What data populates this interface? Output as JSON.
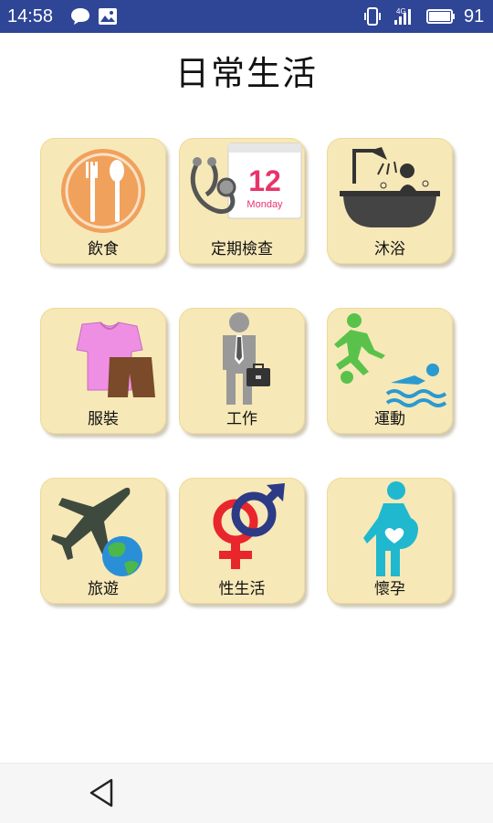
{
  "status_bar": {
    "time": "14:58",
    "battery": "91",
    "icons": [
      "message-icon",
      "image-icon",
      "vibrate-icon",
      "signal-icon",
      "battery-icon"
    ]
  },
  "title": "日常生活",
  "tiles": [
    {
      "label": "飲食",
      "icon": "dining-icon"
    },
    {
      "label": "定期檢查",
      "icon": "checkup-icon",
      "calendar_day": "12",
      "calendar_weekday": "Monday"
    },
    {
      "label": "沐浴",
      "icon": "bath-icon"
    },
    {
      "label": "服裝",
      "icon": "clothing-icon"
    },
    {
      "label": "工作",
      "icon": "work-icon"
    },
    {
      "label": "運動",
      "icon": "sports-icon"
    },
    {
      "label": "旅遊",
      "icon": "travel-icon"
    },
    {
      "label": "性生活",
      "icon": "gender-icon"
    },
    {
      "label": "懷孕",
      "icon": "pregnancy-icon"
    }
  ],
  "nav": {
    "back": "back-icon"
  },
  "colors": {
    "status_bar": "#2f4596",
    "tile_bg": "#f7e8b8",
    "accent_pink": "#e8336b"
  }
}
